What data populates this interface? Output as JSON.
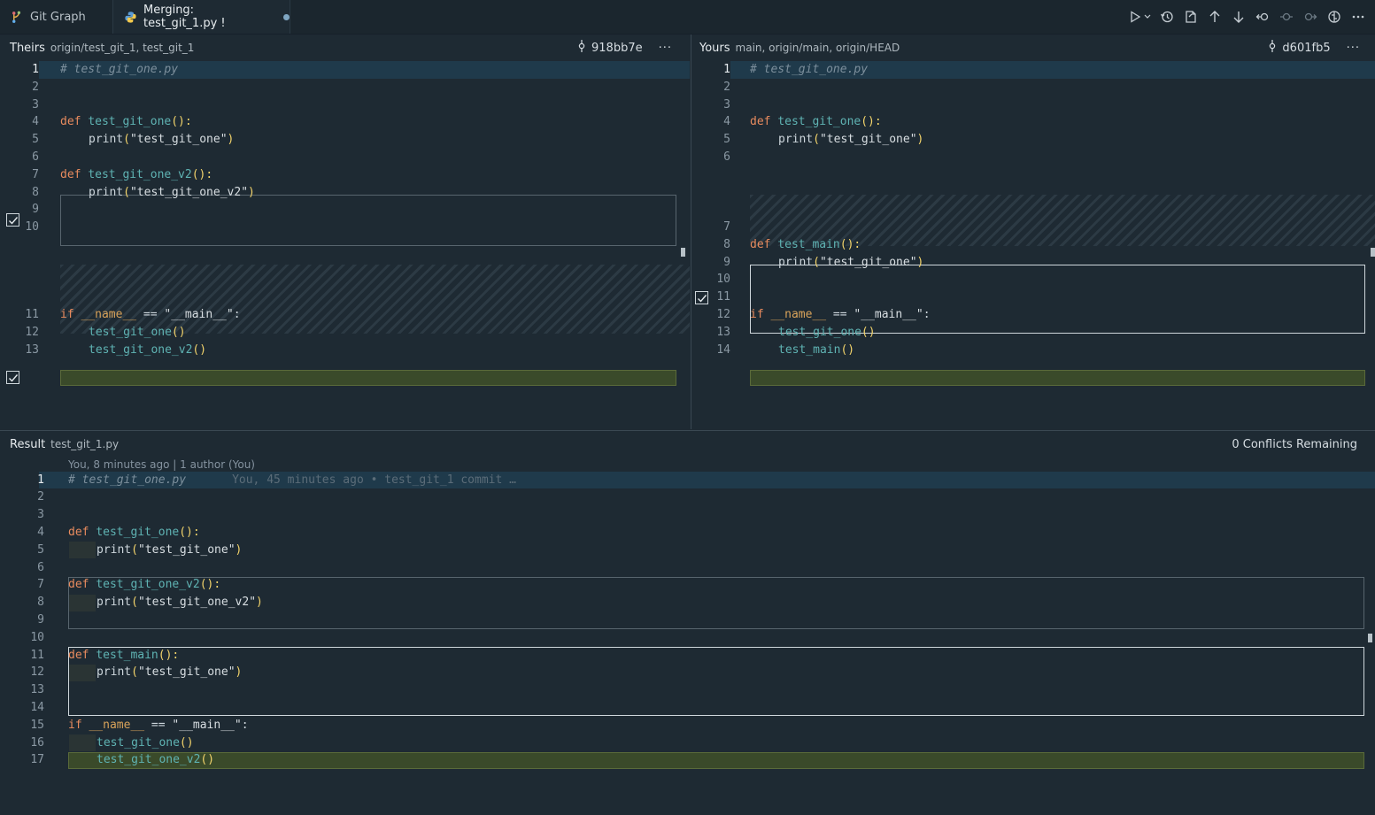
{
  "tabs": [
    {
      "label": "Git Graph"
    },
    {
      "label": "Merging: test_git_1.py !"
    }
  ],
  "theirs": {
    "title": "Theirs",
    "desc": "origin/test_git_1, test_git_1",
    "commit": "918bb7e",
    "more": "···"
  },
  "yours": {
    "title": "Yours",
    "desc": "main, origin/main, origin/HEAD",
    "commit": "d601fb5",
    "more": "···"
  },
  "result": {
    "title": "Result",
    "desc": "test_git_1.py",
    "status": "0 Conflicts Remaining",
    "codelens": "You, 8 minutes ago | 1 author (You)",
    "blame": "You, 45 minutes ago • test_git_1 commit …"
  },
  "code": {
    "comment": "# test_git_one.py",
    "def": "def",
    "if": "if",
    "print": "print",
    "fn_one": "test_git_one",
    "fn_v2": "test_git_one_v2",
    "fn_main": "test_main",
    "str_one": "\"test_git_one\"",
    "str_v2": "\"test_git_one_v2\"",
    "name_var": "__name__",
    "eq": " == ",
    "main_str": "\"__main__\"",
    "open": "(",
    "close": ")",
    "parens": "()",
    "colon": ":",
    "defparens": "():"
  },
  "line_numbers": {
    "theirs": [
      "1",
      "2",
      "3",
      "4",
      "5",
      "6",
      "7",
      "8",
      "9",
      "10",
      "11",
      "12",
      "13"
    ],
    "yours": [
      "1",
      "2",
      "3",
      "4",
      "5",
      "6",
      "7",
      "8",
      "9",
      "10",
      "11",
      "12",
      "13",
      "14"
    ],
    "result": [
      "1",
      "2",
      "3",
      "4",
      "5",
      "6",
      "7",
      "8",
      "9",
      "10",
      "11",
      "12",
      "13",
      "14",
      "15",
      "16",
      "17"
    ]
  },
  "icons": [
    "git-graph-icon",
    "python-file-icon",
    "run-icon",
    "history-icon",
    "open-file-icon",
    "arrow-up-icon",
    "arrow-down-icon",
    "revert-icon",
    "previous-change-icon",
    "next-change-icon",
    "compare-icon",
    "more-icon",
    "commit-icon",
    "checkbox-icon"
  ]
}
